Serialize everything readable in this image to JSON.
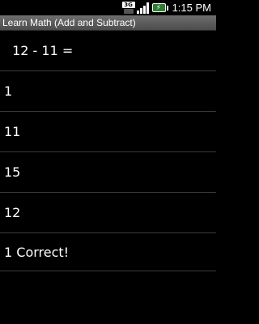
{
  "status_bar": {
    "network_badge": "3G",
    "time": "1:15 PM",
    "icons": {
      "network": "network-3g-icon",
      "signal": "signal-strength-icon",
      "battery": "battery-charging-icon"
    },
    "colors": {
      "battery": "#2e7d32"
    }
  },
  "app": {
    "title": "Learn Math (Add and Subtract)"
  },
  "quiz": {
    "question": " 12 - 11 =",
    "answers": [
      "1",
      "11",
      "15",
      "12"
    ],
    "score_text": "1 Correct!"
  }
}
